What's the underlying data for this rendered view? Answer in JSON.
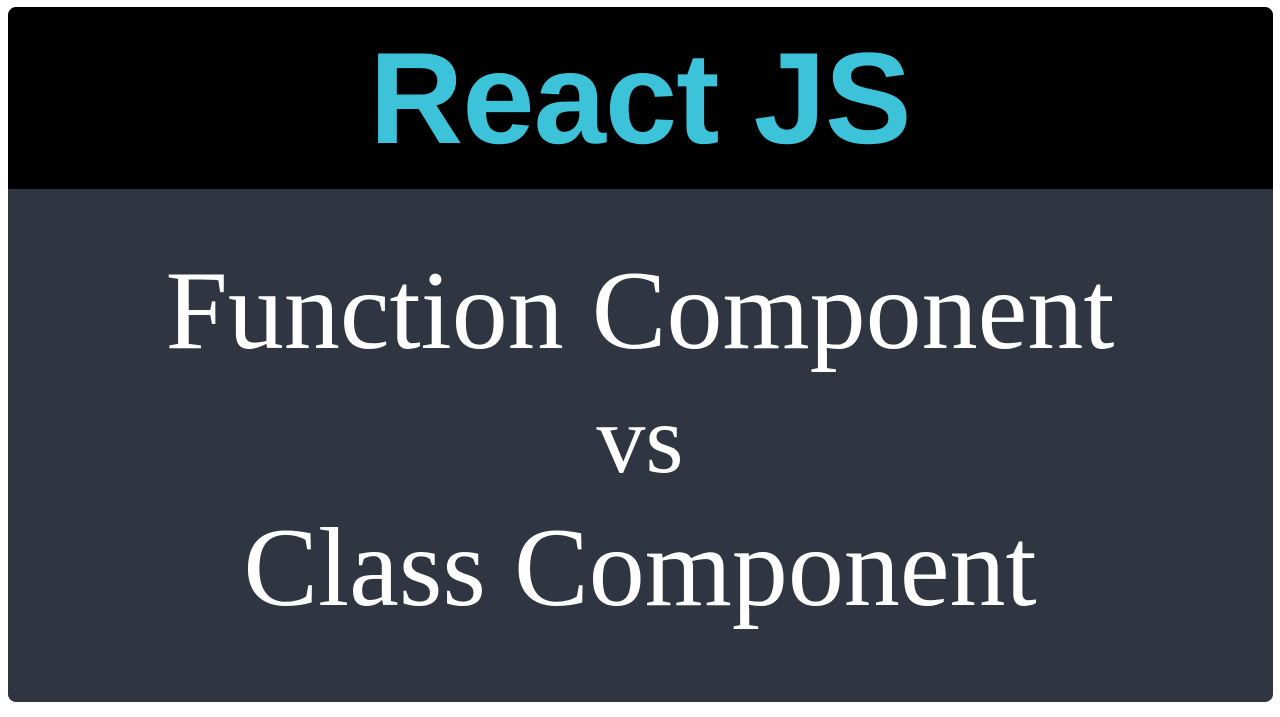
{
  "header": {
    "title": "React JS"
  },
  "body": {
    "line1": "Function Component",
    "line2": "vs",
    "line3": "Class Component"
  }
}
